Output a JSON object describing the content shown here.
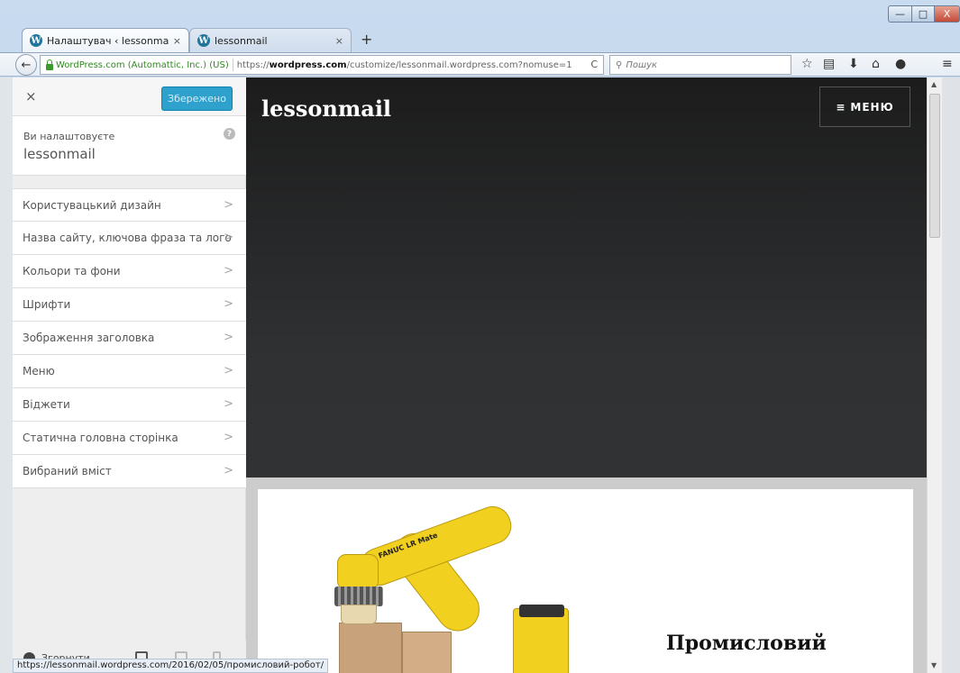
{
  "browser": {
    "tabs": [
      {
        "label": "Налаштувач ‹ lessonma...",
        "close": "×"
      },
      {
        "label": "lessonmail",
        "close": "×"
      }
    ],
    "new_tab": "+",
    "window": {
      "minimize": "—",
      "maximize": "□",
      "close": "X"
    },
    "identity": "WordPress.com (Automattic, Inc.) (US)",
    "url_scheme": "https://",
    "url_host": "wordpress.com",
    "url_path": "/customize/lessonmail.wordpress.com?nomuse=1",
    "reload": "C",
    "search_placeholder": "Пошук",
    "status_url": "https://lessonmail.wordpress.com/2016/02/05/промисловий-робот/"
  },
  "customizer": {
    "close": "×",
    "saved_label": "Збережено",
    "info_prefix": "Ви налаштовуєте",
    "site_name": "lessonmail",
    "help": "?",
    "sections": [
      "Користувацький дизайн",
      "Назва сайту, ключова фраза та лого",
      "Кольори та фони",
      "Шрифти",
      "Зображення заголовка",
      "Меню",
      "Віджети",
      "Статична головна сторінка",
      "Вибраний вміст"
    ],
    "chevron": ">",
    "collapse_label": "Згорнути"
  },
  "preview": {
    "site_title": "lessonmail",
    "menu_label": "МЕНЮ",
    "menu_bars": "≡",
    "post_title": "Промисловий",
    "robot_brand": "FANUC LR Mate"
  },
  "colors": {
    "saved_button": "#2ea2cc",
    "hero_bg": "#1c1c1c",
    "robot_yellow": "#f2d01f",
    "identity_green": "#2f8a1f"
  }
}
